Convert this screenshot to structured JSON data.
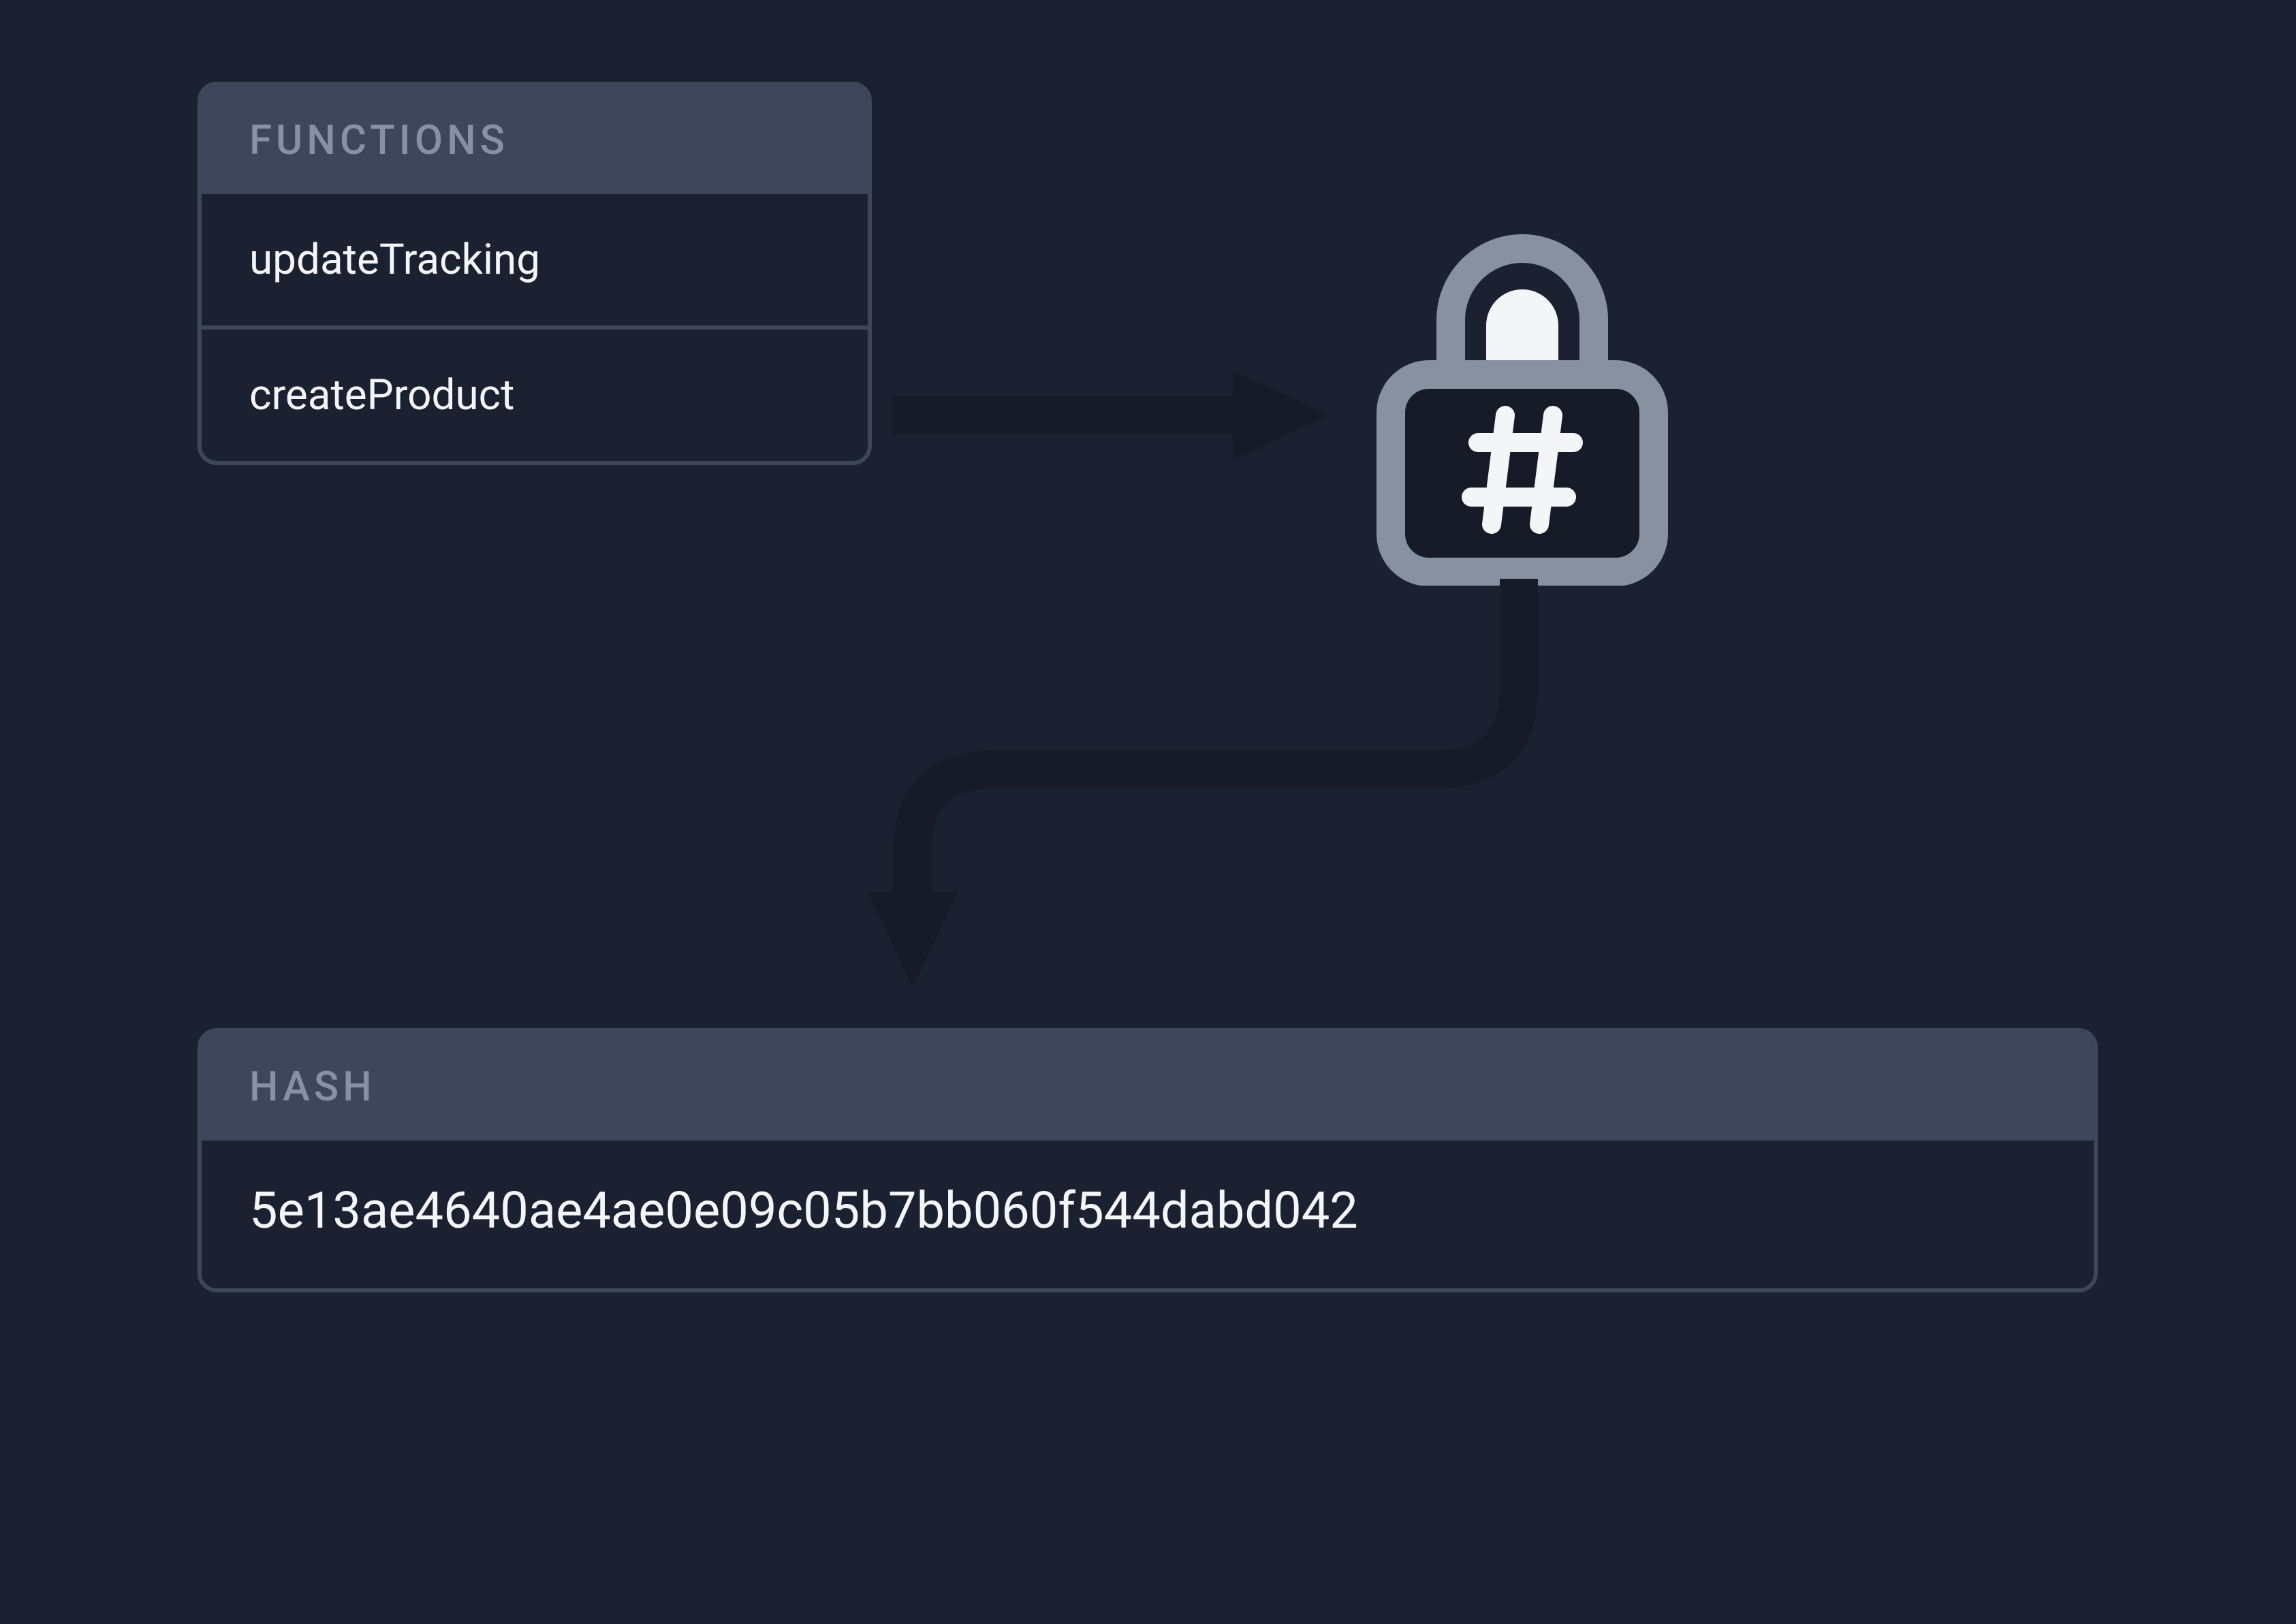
{
  "functions": {
    "title": "FUNCTIONS",
    "items": [
      "updateTracking",
      "createProduct"
    ]
  },
  "hash": {
    "title": "HASH",
    "value": "5e13ae4640ae4ae0e09c05b7bb060f544dabd042"
  },
  "icons": {
    "lock": "lock-hash-icon"
  },
  "colors": {
    "bg": "#1b2130",
    "panel": "#3e475a",
    "muted": "#8891a2",
    "text": "#f4f5f7",
    "dark": "#161b27"
  }
}
